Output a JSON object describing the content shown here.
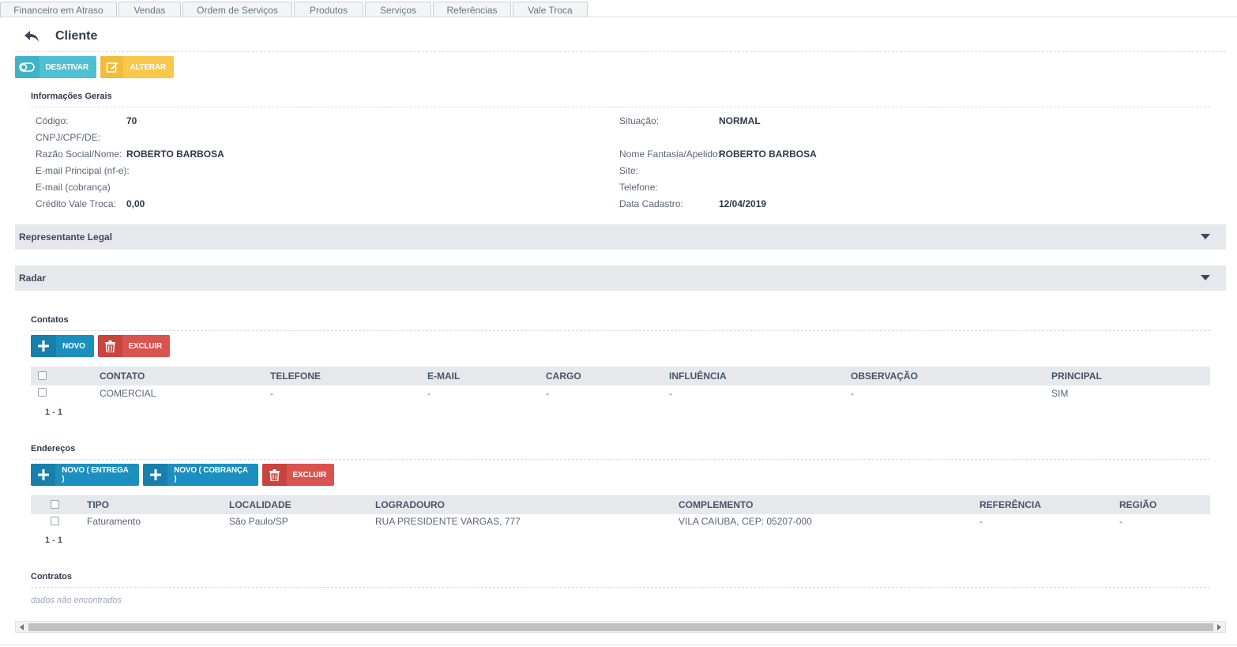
{
  "tabs": [
    "Financeiro em Atraso",
    "Vendas",
    "Ordem de Serviços",
    "Produtos",
    "Serviços",
    "Referências",
    "Vale Troca"
  ],
  "header": {
    "title": "Cliente"
  },
  "actions": {
    "deactivate": "DESATIVAR",
    "edit": "ALTERAR"
  },
  "general": {
    "title": "Informações Gerais",
    "left": [
      {
        "label": "Código:",
        "value": "70"
      },
      {
        "label": "CNPJ/CPF/DE:",
        "value": ""
      },
      {
        "label": "Razão Social/Nome:",
        "value": "ROBERTO BARBOSA"
      },
      {
        "label": "E-mail Principal (nf-e):",
        "value": ""
      },
      {
        "label": "E-mail (cobrança)",
        "value": ""
      },
      {
        "label": "Crédito Vale Troca:",
        "value": "0,00"
      }
    ],
    "right": [
      {
        "label": "Situação:",
        "value": "NORMAL"
      },
      {
        "label": "",
        "value": ""
      },
      {
        "label": "Nome Fantasia/Apelido:",
        "value": "ROBERTO BARBOSA"
      },
      {
        "label": "Site:",
        "value": ""
      },
      {
        "label": "Telefone:",
        "value": ""
      },
      {
        "label": "Data Cadastro:",
        "value": "12/04/2019"
      }
    ]
  },
  "panels": {
    "legal": "Representante Legal",
    "radar": "Radar"
  },
  "contacts": {
    "title": "Contatos",
    "new_label": "NOVO",
    "delete_label": "EXCLUIR",
    "columns": [
      "CONTATO",
      "TELEFONE",
      "E-MAIL",
      "CARGO",
      "INFLUÊNCIA",
      "OBSERVAÇÃO",
      "PRINCIPAL"
    ],
    "rows": [
      [
        "COMERCIAL",
        "-",
        "-",
        "-",
        "-",
        "-",
        "SIM"
      ]
    ],
    "pager": "1 - 1"
  },
  "addresses": {
    "title": "Endereços",
    "new_delivery_label": "NOVO ( ENTREGA )",
    "new_billing_label": "NOVO ( COBRANÇA )",
    "delete_label": "EXCLUIR",
    "columns": [
      "TIPO",
      "LOCALIDADE",
      "LOGRADOURO",
      "COMPLEMENTO",
      "REFERÊNCIA",
      "REGIÃO"
    ],
    "rows": [
      [
        "Faturamento",
        "São Paulo/SP",
        "RUA PRESIDENTE VARGAS, 777",
        "VILA CAIUBA, CEP: 05207-000",
        "-",
        "-"
      ]
    ],
    "pager": "1 - 1"
  },
  "contracts": {
    "title": "Contratos",
    "empty": "dados não encontrados"
  },
  "colors": {
    "teal": "#4fc0d1",
    "yellow": "#f8c84c",
    "blue": "#1b8fbe",
    "red": "#d9534f"
  },
  "icons": {
    "back": "back-arrow-icon",
    "toggle": "toggle-icon",
    "edit": "edit-icon",
    "plus": "plus-icon",
    "trash": "trash-icon",
    "caret": "caret-down-icon"
  }
}
